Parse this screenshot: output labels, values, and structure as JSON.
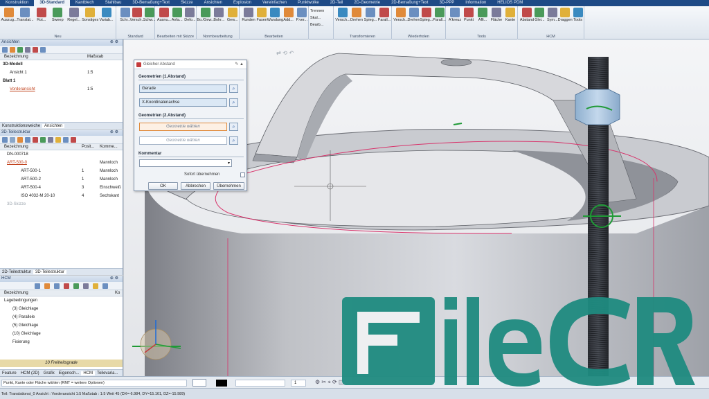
{
  "menu_tabs": [
    "Konstruktion",
    "3D-Standard",
    "Kantblech",
    "Stahlbau",
    "3D-Bemaßung+Text",
    "Skizze",
    "Ansichten",
    "Explosion",
    "Vereinfachen",
    "Punktwolke",
    "2D-Teil",
    "2D-Geometrie",
    "2D-Bemaßung+Text",
    "3D-PPP",
    "Information",
    "HELIOS PDM"
  ],
  "ribbon": {
    "groups": [
      {
        "label": "Neu",
        "buttons": [
          "Auszug...",
          "Translat...",
          "Rot...",
          "Sweep",
          "Regel...",
          "Sonstiges",
          "Variab..."
        ]
      },
      {
        "label": "Standard",
        "buttons": [
          "Schr...",
          "Versch...",
          "Schw..."
        ]
      },
      {
        "label": "Bearbeiten mit Skizze",
        "buttons": [
          "Ausnu...",
          "Anfa...",
          "Defo..."
        ]
      },
      {
        "label": "Normbearbeitung",
        "buttons": [
          "Bo./Gew...",
          "Bohr...",
          "Gew..."
        ]
      },
      {
        "label": "Bearbeiten",
        "buttons": [
          "Runden",
          "Fasen",
          "Wandung",
          "Add...",
          "P.ver..."
        ]
      },
      {
        "label": "",
        "small": [
          "Trennen",
          "Skal...",
          "Bearb..."
        ]
      },
      {
        "label": "Transformieren",
        "buttons": [
          "Versch...",
          "Drehen",
          "Spieg...",
          "Parall..."
        ]
      },
      {
        "label": "Wiederholen",
        "buttons": [
          "Versch...",
          "Drehen",
          "Spieg...",
          "Parall..."
        ]
      },
      {
        "label": "Tools",
        "buttons": [
          "A'kreuz",
          "Punkt",
          "Affi...",
          "Fläche",
          "Kante"
        ]
      },
      {
        "label": "HCM",
        "buttons": [
          "Abstand",
          "Glei...",
          "Sym...",
          "Draggen",
          "Tools"
        ]
      }
    ]
  },
  "panel_views": {
    "title": "Ansichten",
    "col_name": "Bezeichnung",
    "col_scale": "Maßstab",
    "rows": [
      {
        "name": "3D-Modell",
        "scale": "",
        "bold": true
      },
      {
        "name": "Ansicht 1",
        "scale": "1:5",
        "bold": false
      },
      {
        "name": "Blatt 1",
        "scale": "",
        "bold": true
      },
      {
        "name": "Vorderansicht",
        "scale": "1:5",
        "bold": false
      }
    ],
    "tabs": [
      "Konstruktionsweiche",
      "Ansichten"
    ]
  },
  "panel_parts": {
    "title": "3D-Teilestruktur",
    "col_name": "Bezeichnung",
    "col_pos": "Posit...",
    "col_comment": "Komme...",
    "rows": [
      {
        "name": "DN-000718",
        "pos": "",
        "comment": ""
      },
      {
        "name": "ART-500-0",
        "pos": "",
        "comment": "Mannloch"
      },
      {
        "name": "ART-500-1",
        "pos": "1",
        "comment": "Mannloch"
      },
      {
        "name": "ART-500-2",
        "pos": "1",
        "comment": "Mannloch"
      },
      {
        "name": "ART-500-4",
        "pos": "3",
        "comment": "Einschweiß"
      },
      {
        "name": "ISO 4032-M 20-10",
        "pos": "4",
        "comment": "Sechskant"
      },
      {
        "name": "3D-Skizze",
        "pos": "",
        "comment": ""
      }
    ],
    "tabs": [
      "2D-Teilestruktur",
      "3D-Teilestruktur"
    ]
  },
  "panel_hcm": {
    "title": "HCM",
    "col_name": "Bezeichnung",
    "col_k": "Ko",
    "rows": [
      {
        "name": "Lagebedingungen",
        "indent": 0
      },
      {
        "name": "(3) Gleichlage",
        "indent": 1
      },
      {
        "name": "(4) Parallele",
        "indent": 1
      },
      {
        "name": "(5) Gleichlage",
        "indent": 1
      },
      {
        "name": "(10) Gleichlage",
        "indent": 1
      },
      {
        "name": "Fixierung",
        "indent": 1
      }
    ],
    "footer": "10 Freiheitsgrade",
    "tabs": [
      "Feature",
      "HCM (2D)",
      "Grafik",
      "Eigensch...",
      "HCM",
      "Teilevaria..."
    ]
  },
  "dialog": {
    "title": "Gleicher Abstand",
    "sec1": "Geometrien (1.Abstand)",
    "field1": "Gerade",
    "field2": "X-Koordinatenachse",
    "sec2": "Geometrien (2.Abstand)",
    "field3": "Geometrie wählen",
    "field4": "Geometrie wählen",
    "sec3": "Kommentar",
    "checkbox": "Sofort übernehmen",
    "ok": "OK",
    "cancel": "Abbrechen",
    "apply": "Übernehmen"
  },
  "toolstrip": {
    "prompt": "Punkt, Kante oder Fläche wählen (RMT = weitere Optionen)",
    "line_width": "1"
  },
  "status": {
    "text": "Teil: Translationst_0    Ansicht : Vorderansicht 1:5    Maßstab : 1:5    Weit 45    (DX=-6.984, DY=15.161, DZ=-15.989)"
  },
  "watermark": "FileCR",
  "colors": {
    "ribbon_tab_bar": "#1e4a86",
    "watermark": "#1f8b80",
    "highlight": "#d8326a"
  }
}
